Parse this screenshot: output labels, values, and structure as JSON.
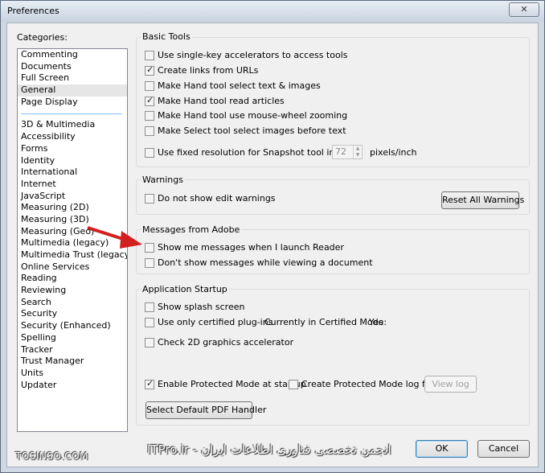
{
  "window": {
    "title": "Preferences",
    "close_glyph": "✕"
  },
  "categories": {
    "label": "Categories:",
    "top_items": [
      "Commenting",
      "Documents",
      "Full Screen",
      "General",
      "Page Display"
    ],
    "selected": "General",
    "items": [
      "3D & Multimedia",
      "Accessibility",
      "Forms",
      "Identity",
      "International",
      "Internet",
      "JavaScript",
      "Measuring (2D)",
      "Measuring (3D)",
      "Measuring (Geo)",
      "Multimedia (legacy)",
      "Multimedia Trust (legacy)",
      "Online Services",
      "Reading",
      "Reviewing",
      "Search",
      "Security",
      "Security (Enhanced)",
      "Spelling",
      "Tracker",
      "Trust Manager",
      "Units",
      "Updater"
    ]
  },
  "basic_tools": {
    "title": "Basic Tools",
    "single_key": {
      "label": "Use single-key accelerators to access tools",
      "checked": false
    },
    "create_links": {
      "label": "Create links from URLs",
      "checked": true
    },
    "hand_select": {
      "label": "Make Hand tool select text & images",
      "checked": false
    },
    "hand_read": {
      "label": "Make Hand tool read articles",
      "checked": true
    },
    "hand_zoom": {
      "label": "Make Hand tool use mouse-wheel zooming",
      "checked": false
    },
    "select_images": {
      "label": "Make Select tool select images before text",
      "checked": false
    },
    "fixed_res": {
      "label": "Use fixed resolution for Snapshot tool images:",
      "checked": false
    },
    "res_value": "72",
    "res_unit": "pixels/inch"
  },
  "warnings": {
    "title": "Warnings",
    "no_edit": {
      "label": "Do not show edit warnings",
      "checked": false
    },
    "reset_label": "Reset All Warnings"
  },
  "messages": {
    "title": "Messages from Adobe",
    "show_launch": {
      "label": "Show me messages when I launch Reader",
      "checked": false
    },
    "dont_show": {
      "label": "Don't show messages while viewing a document",
      "checked": false
    }
  },
  "startup": {
    "title": "Application Startup",
    "splash": {
      "label": "Show splash screen",
      "checked": false
    },
    "certified": {
      "label": "Use only certified plug-ins",
      "checked": false
    },
    "certified_mode_label": "Currently in Certified Mode:",
    "certified_mode_value": "Yes",
    "gpu": {
      "label": "Check 2D graphics accelerator",
      "checked": false
    },
    "protected": {
      "label": "Enable Protected Mode at startup",
      "checked": true
    },
    "log_file": {
      "label": "Create Protected Mode log file",
      "checked": false
    },
    "view_log_label": "View log",
    "default_pdf_label": "Select Default PDF Handler"
  },
  "footer": {
    "ok_label": "OK",
    "cancel_label": "Cancel",
    "watermark_left": "TOSINSO.COM",
    "watermark_right": "ITPro.ir - انجمن تخصصی فناوری اطلاعات ایران"
  },
  "colors": {
    "arrow": "#d21f1f",
    "selection_line": "#3399ff"
  }
}
